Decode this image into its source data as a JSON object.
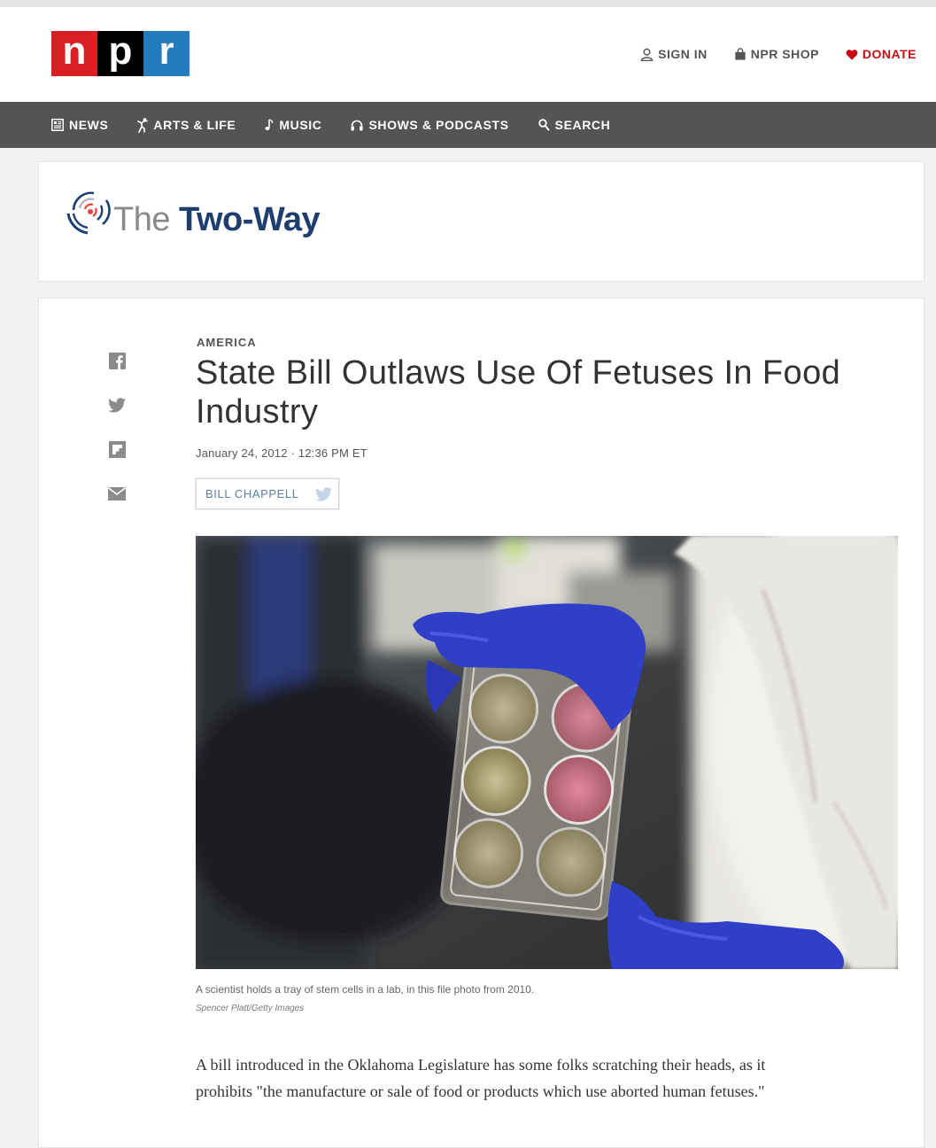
{
  "header": {
    "logo": [
      "n",
      "p",
      "r"
    ],
    "utility": [
      {
        "label": "SIGN IN",
        "icon": "user-icon"
      },
      {
        "label": "NPR SHOP",
        "icon": "shopping-bag-icon"
      },
      {
        "label": "DONATE",
        "icon": "heart-icon"
      }
    ]
  },
  "nav": [
    {
      "label": "NEWS",
      "icon": "newspaper-icon"
    },
    {
      "label": "ARTS & LIFE",
      "icon": "dancer-icon"
    },
    {
      "label": "MUSIC",
      "icon": "music-note-icon"
    },
    {
      "label": "SHOWS & PODCASTS",
      "icon": "headphones-icon"
    },
    {
      "label": "SEARCH",
      "icon": "search-icon"
    }
  ],
  "blog": {
    "the": "The",
    "name": "Two-Way"
  },
  "share": [
    "facebook-icon",
    "twitter-icon",
    "flipboard-icon",
    "email-icon"
  ],
  "article": {
    "slug": "AMERICA",
    "headline": "State Bill Outlaws Use Of Fetuses In Food Industry",
    "date": "January 24, 2012 · 12:36 PM ET",
    "author": "BILL CHAPPELL",
    "caption": "A scientist holds a tray of stem cells in a lab, in this file photo from 2010.",
    "credit": "Spencer Platt/Getty Images",
    "body": "A bill introduced in the Oklahoma Legislature has some folks scratching their heads, as it prohibits \"the manufacture or sale of food or products which use aborted human fetuses.\""
  },
  "colors": {
    "npr_red": "#d62021",
    "npr_black": "#000000",
    "npr_blue": "#237bbd",
    "nav_bg": "#545454",
    "donate": "#c40e13",
    "glove_blue": "#2f3fc7"
  }
}
